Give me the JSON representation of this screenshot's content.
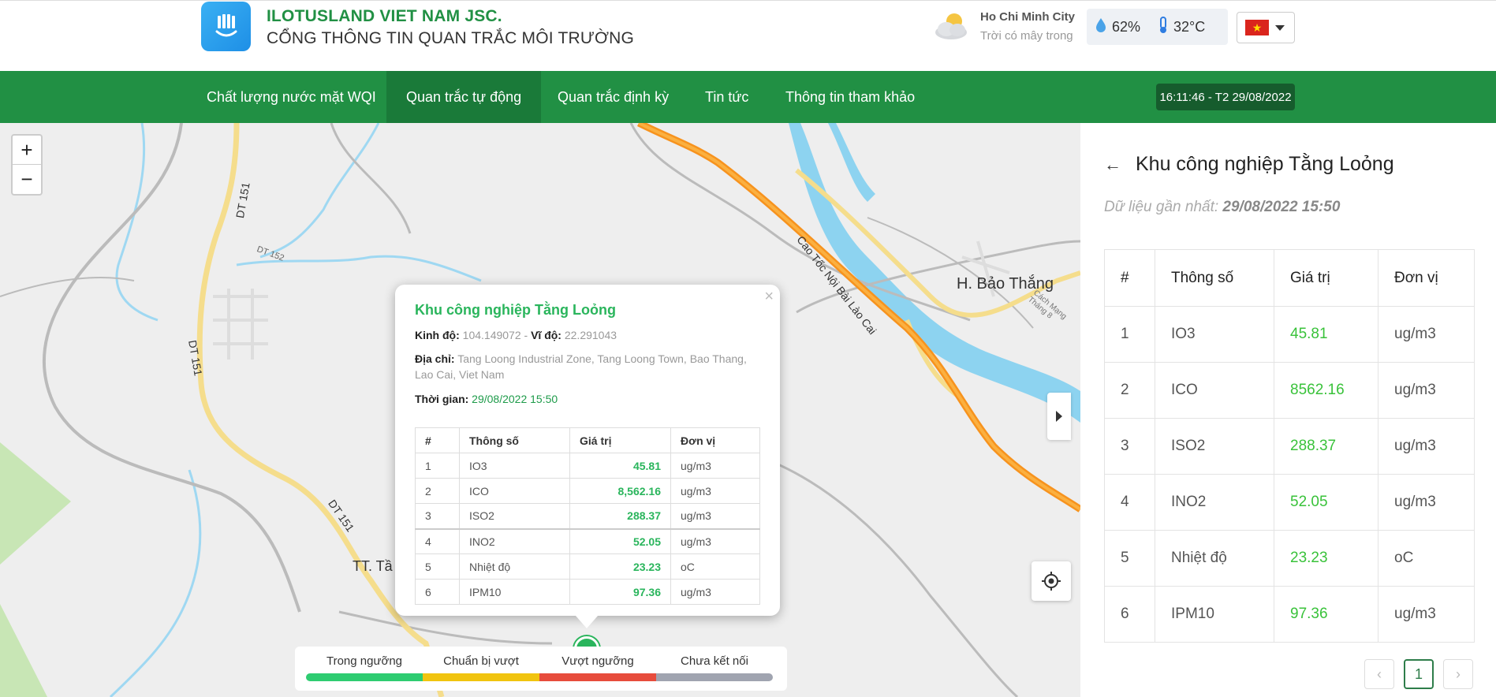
{
  "brand": {
    "name": "ILOTUSLAND VIET NAM JSC.",
    "subtitle": "CỔNG THÔNG TIN QUAN TRẮC MÔI TRƯỜNG",
    "logo_icon": "lotus-logo-icon"
  },
  "weather": {
    "city": "Ho Chi Minh City",
    "condition": "Trời có mây trong",
    "humidity": "62%",
    "temperature": "32°C",
    "icon": "cloud-sun-icon"
  },
  "language": {
    "selected": "vietnam-flag",
    "icon": "chevron-down-icon"
  },
  "nav": {
    "items": [
      {
        "label": "Chất lượng nước mặt WQI",
        "active": false
      },
      {
        "label": "Quan trắc tự động",
        "active": true
      },
      {
        "label": "Quan trắc định kỳ",
        "active": false
      },
      {
        "label": "Tin tức",
        "active": false
      },
      {
        "label": "Thông tin tham khảo",
        "active": false
      }
    ],
    "clock": "16:11:46 - T2 29/08/2022"
  },
  "map": {
    "zoom_in": "+",
    "zoom_out": "−",
    "labels": {
      "road_dt151_a": "DT 151",
      "road_dt152": "DT 152",
      "road_dt151_b": "DT 151",
      "road_dt151_c": "DT 151",
      "highway": "Cao Tốc Nội Bài Lào Cai",
      "district": "H. Bảo Thắng",
      "street": "Cách Mạng Tháng 8",
      "town": "TT. Tầ"
    }
  },
  "popup": {
    "close": "×",
    "title": "Khu công nghiệp Tằng Loỏng",
    "longitude_label": "Kinh độ:",
    "longitude": "104.149072",
    "separator": "-",
    "latitude_label": "Vĩ độ:",
    "latitude": "22.291043",
    "address_label": "Địa chỉ:",
    "address": "Tang Loong Industrial Zone, Tang Loong Town, Bao Thang, Lao Cai, Viet Nam",
    "time_label": "Thời gian:",
    "time": "29/08/2022 15:50",
    "headers": [
      "#",
      "Thông số",
      "Giá trị",
      "Đơn vị"
    ],
    "rows": [
      {
        "no": "1",
        "param": "IO3",
        "value": "45.81",
        "unit": "ug/m3"
      },
      {
        "no": "2",
        "param": "ICO",
        "value": "8,562.16",
        "unit": "ug/m3"
      },
      {
        "no": "3",
        "param": "ISO2",
        "value": "288.37",
        "unit": "ug/m3"
      },
      {
        "no": "4",
        "param": "INO2",
        "value": "52.05",
        "unit": "ug/m3"
      },
      {
        "no": "5",
        "param": "Nhiệt độ",
        "value": "23.23",
        "unit": "oC"
      },
      {
        "no": "6",
        "param": "IPM10",
        "value": "97.36",
        "unit": "ug/m3"
      }
    ]
  },
  "legend": {
    "items": [
      {
        "label": "Trong ngưỡng",
        "color": "#2ecc71"
      },
      {
        "label": "Chuẩn bị vượt",
        "color": "#f1c40f"
      },
      {
        "label": "Vượt ngưỡng",
        "color": "#e74c3c"
      },
      {
        "label": "Chưa kết nối",
        "color": "#a0a4b0"
      }
    ]
  },
  "sidebar": {
    "back_icon": "←",
    "title": "Khu công nghiệp Tằng Loỏng",
    "latest_label": "Dữ liệu gần nhất:",
    "latest_time": "29/08/2022 15:50",
    "headers": [
      "#",
      "Thông số",
      "Giá trị",
      "Đơn vị"
    ],
    "rows": [
      {
        "no": "1",
        "param": "IO3",
        "value": "45.81",
        "unit": "ug/m3"
      },
      {
        "no": "2",
        "param": "ICO",
        "value": "8562.16",
        "unit": "ug/m3"
      },
      {
        "no": "3",
        "param": "ISO2",
        "value": "288.37",
        "unit": "ug/m3"
      },
      {
        "no": "4",
        "param": "INO2",
        "value": "52.05",
        "unit": "ug/m3"
      },
      {
        "no": "5",
        "param": "Nhiệt độ",
        "value": "23.23",
        "unit": "oC"
      },
      {
        "no": "6",
        "param": "IPM10",
        "value": "97.36",
        "unit": "ug/m3"
      }
    ],
    "pagination": {
      "prev": "‹",
      "current": "1",
      "next": "›"
    }
  },
  "colors": {
    "brand_green": "#219044",
    "value_green": "#39c23a",
    "river_blue": "#8dd3f0",
    "highway_orange": "#f7931e"
  }
}
